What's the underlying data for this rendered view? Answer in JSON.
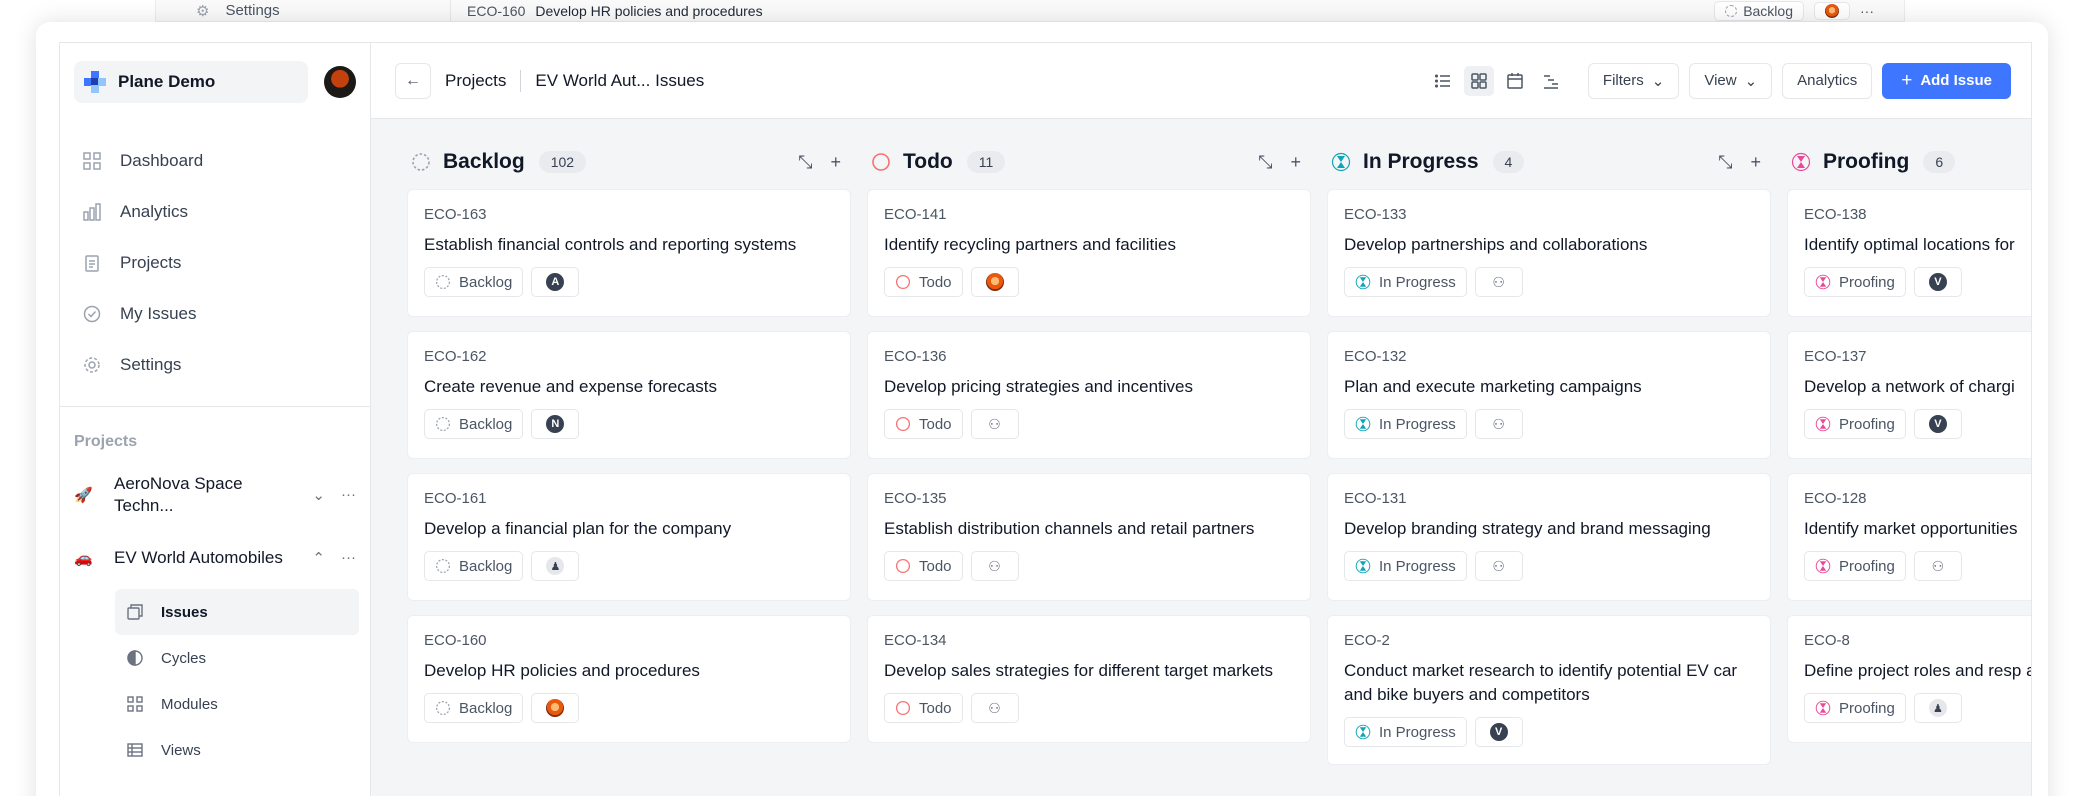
{
  "ghost_row": {
    "settings": "Settings",
    "issue_id": "ECO-160",
    "issue_title": "Develop HR policies and procedures",
    "state": "Backlog",
    "more": "···"
  },
  "workspace": {
    "name": "Plane Demo"
  },
  "nav": [
    {
      "label": "Dashboard",
      "icon": "grid-icon"
    },
    {
      "label": "Analytics",
      "icon": "bar-chart-icon"
    },
    {
      "label": "Projects",
      "icon": "clipboard-icon"
    },
    {
      "label": "My Issues",
      "icon": "check-circle-icon"
    },
    {
      "label": "Settings",
      "icon": "gear-icon"
    }
  ],
  "projects_label": "Projects",
  "projects": [
    {
      "name": "AeroNova Space Techn...",
      "emoji": "🚀",
      "expanded": false
    },
    {
      "name": "EV World Automobiles",
      "emoji": "🚗",
      "expanded": true
    }
  ],
  "sub_nav": [
    {
      "label": "Issues",
      "active": true
    },
    {
      "label": "Cycles",
      "active": false
    },
    {
      "label": "Modules",
      "active": false
    },
    {
      "label": "Views",
      "active": false
    }
  ],
  "topbar": {
    "crumb_projects": "Projects",
    "crumb_current": "EV World Aut... Issues",
    "filters": "Filters",
    "view": "View",
    "analytics": "Analytics",
    "add_issue": "Add Issue"
  },
  "colors": {
    "accent": "#3f76ff",
    "backlog": "#9ca3af",
    "todo": "#f87171",
    "in_progress": "#0ea5b7",
    "proofing": "#ec4899"
  },
  "columns": [
    {
      "title": "Backlog",
      "count": "102",
      "state": "backlog",
      "cards": [
        {
          "id": "ECO-163",
          "title": "Establish financial controls and reporting systems",
          "state": "Backlog",
          "assignee": "A"
        },
        {
          "id": "ECO-162",
          "title": "Create revenue and expense forecasts",
          "state": "Backlog",
          "assignee": "N"
        },
        {
          "id": "ECO-161",
          "title": "Develop a financial plan for the company",
          "state": "Backlog",
          "assignee": "bot"
        },
        {
          "id": "ECO-160",
          "title": "Develop HR policies and procedures",
          "state": "Backlog",
          "assignee": "photo"
        }
      ]
    },
    {
      "title": "Todo",
      "count": "11",
      "state": "todo",
      "cards": [
        {
          "id": "ECO-141",
          "title": "Identify recycling partners and facilities",
          "state": "Todo",
          "assignee": "photo"
        },
        {
          "id": "ECO-136",
          "title": "Develop pricing strategies and incentives",
          "state": "Todo",
          "assignee": "group"
        },
        {
          "id": "ECO-135",
          "title": "Establish distribution channels and retail partners",
          "state": "Todo",
          "assignee": "group"
        },
        {
          "id": "ECO-134",
          "title": "Develop sales strategies for different target markets",
          "state": "Todo",
          "assignee": "group"
        }
      ]
    },
    {
      "title": "In Progress",
      "count": "4",
      "state": "in_progress",
      "cards": [
        {
          "id": "ECO-133",
          "title": "Develop partnerships and collaborations",
          "state": "In Progress",
          "assignee": "group"
        },
        {
          "id": "ECO-132",
          "title": "Plan and execute marketing campaigns",
          "state": "In Progress",
          "assignee": "group"
        },
        {
          "id": "ECO-131",
          "title": "Develop branding strategy and brand messaging",
          "state": "In Progress",
          "assignee": "group"
        },
        {
          "id": "ECO-2",
          "title": "Conduct market research to identify potential EV car and bike buyers and competitors",
          "state": "In Progress",
          "assignee": "V"
        }
      ]
    },
    {
      "title": "Proofing",
      "count": "6",
      "state": "proofing",
      "cards": [
        {
          "id": "ECO-138",
          "title": "Identify optimal locations for",
          "state": "Proofing",
          "assignee": "V"
        },
        {
          "id": "ECO-137",
          "title": "Develop a network of chargi",
          "state": "Proofing",
          "assignee": "V"
        },
        {
          "id": "ECO-128",
          "title": "Identify market opportunities",
          "state": "Proofing",
          "assignee": "group"
        },
        {
          "id": "ECO-8",
          "title": "Define project roles and resp asks to team members",
          "state": "Proofing",
          "assignee": "bot"
        }
      ]
    }
  ]
}
